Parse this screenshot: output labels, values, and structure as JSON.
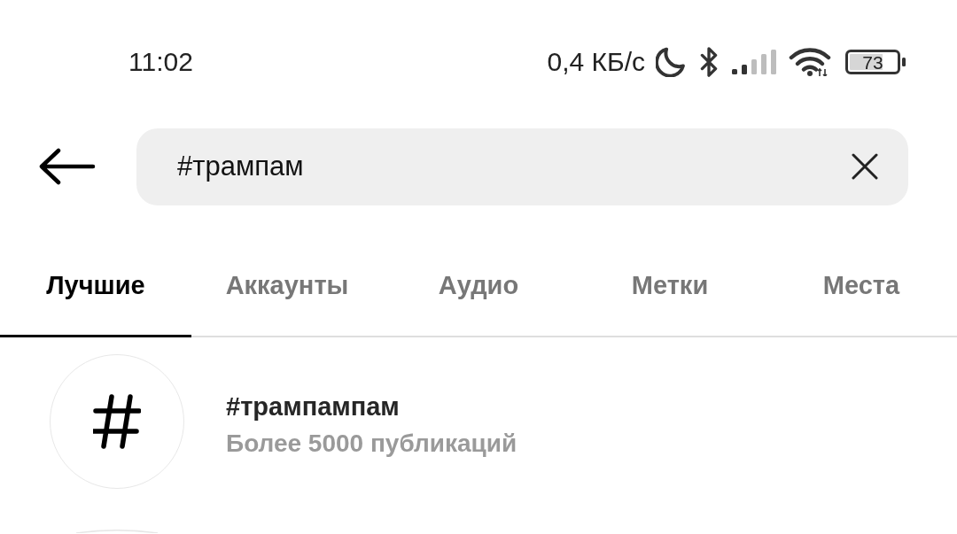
{
  "status_bar": {
    "time": "11:02",
    "network_speed": "0,4 КБ/с",
    "battery": "73"
  },
  "search": {
    "value": "#трампам"
  },
  "tabs": [
    {
      "label": "Лучшие",
      "selected": true
    },
    {
      "label": "Аккаунты",
      "selected": false
    },
    {
      "label": "Аудио",
      "selected": false
    },
    {
      "label": "Метки",
      "selected": false
    },
    {
      "label": "Места",
      "selected": false
    }
  ],
  "results": [
    {
      "kind": "hashtag",
      "title": "#трампампам",
      "subtitle": "Более 5000 публикаций"
    }
  ]
}
